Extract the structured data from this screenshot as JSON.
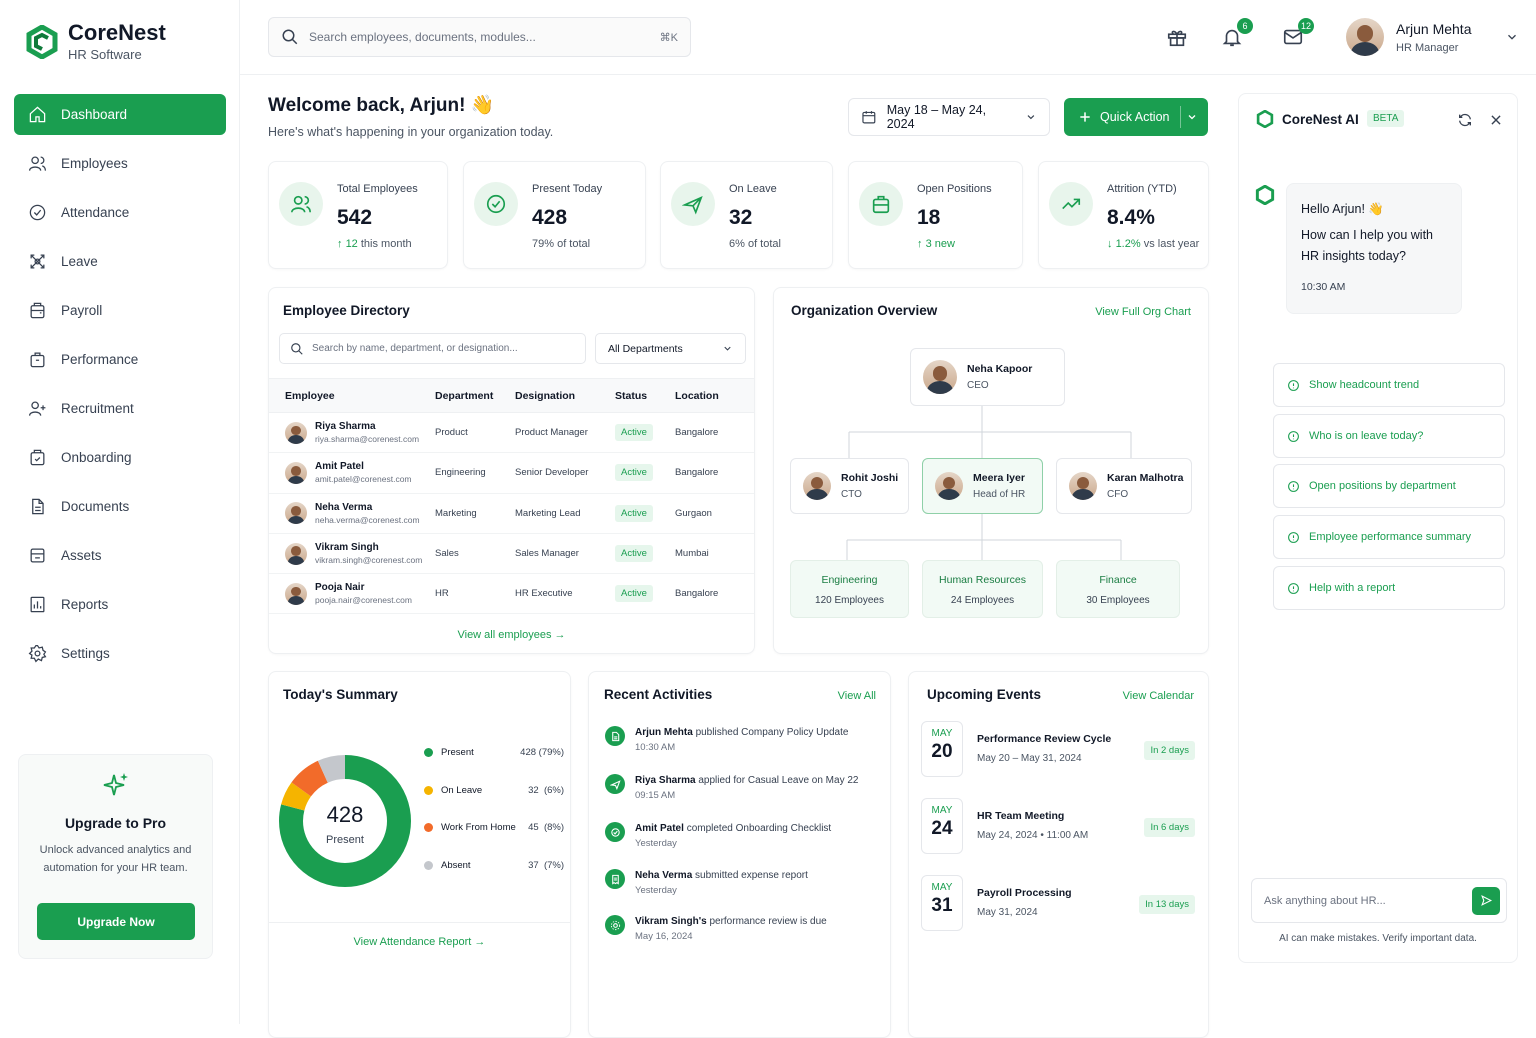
{
  "brand": {
    "name": "CoreNest",
    "subtitle": "HR Software"
  },
  "sidebar": {
    "items": [
      {
        "label": "Dashboard",
        "icon": "home-icon",
        "active": true
      },
      {
        "label": "Employees",
        "icon": "users-icon"
      },
      {
        "label": "Attendance",
        "icon": "check-circle-icon"
      },
      {
        "label": "Leave",
        "icon": "leave-icon"
      },
      {
        "label": "Payroll",
        "icon": "wallet-icon"
      },
      {
        "label": "Performance",
        "icon": "briefcase-icon"
      },
      {
        "label": "Recruitment",
        "icon": "user-plus-icon"
      },
      {
        "label": "Onboarding",
        "icon": "onboarding-icon"
      },
      {
        "label": "Documents",
        "icon": "document-icon"
      },
      {
        "label": "Assets",
        "icon": "assets-icon"
      },
      {
        "label": "Reports",
        "icon": "reports-icon"
      },
      {
        "label": "Settings",
        "icon": "gear-icon"
      }
    ],
    "upgrade": {
      "title": "Upgrade to Pro",
      "text": "Unlock advanced analytics and automation for your HR team.",
      "button": "Upgrade Now"
    }
  },
  "topbar": {
    "search_placeholder": "Search employees, documents, modules...",
    "shortcut": "⌘K",
    "notifications_count": "6",
    "messages_count": "12",
    "user": {
      "name": "Arjun Mehta",
      "role": "HR Manager"
    }
  },
  "header": {
    "welcome": "Welcome back, Arjun! 👋",
    "subtitle": "Here's what's happening in your organization today.",
    "date_range": "May 18 – May 24, 2024",
    "quick_action": "Quick Action"
  },
  "stats": [
    {
      "label": "Total Employees",
      "value": "542",
      "delta": "12",
      "note": "this month"
    },
    {
      "label": "Present Today",
      "value": "428",
      "delta": "",
      "note": "79% of total"
    },
    {
      "label": "On Leave",
      "value": "32",
      "delta": "",
      "note": "6% of total"
    },
    {
      "label": "Open Positions",
      "value": "18",
      "delta": "3",
      "note": "new"
    },
    {
      "label": "Attrition (YTD)",
      "value": "8.4%",
      "delta": "1.2%",
      "note": "vs last year"
    }
  ],
  "directory": {
    "title": "Employee Directory",
    "search_placeholder": "Search by name, department, or designation...",
    "dept_filter": "All Departments",
    "columns": [
      "Employee",
      "Department",
      "Designation",
      "Status",
      "Location"
    ],
    "rows": [
      {
        "name": "Riya Sharma",
        "email": "riya.sharma@corenest.com",
        "dept": "Product",
        "desig": "Product Manager",
        "status": "Active",
        "loc": "Bangalore"
      },
      {
        "name": "Amit Patel",
        "email": "amit.patel@corenest.com",
        "dept": "Engineering",
        "desig": "Senior Developer",
        "status": "Active",
        "loc": "Bangalore"
      },
      {
        "name": "Neha Verma",
        "email": "neha.verma@corenest.com",
        "dept": "Marketing",
        "desig": "Marketing Lead",
        "status": "Active",
        "loc": "Gurgaon"
      },
      {
        "name": "Vikram Singh",
        "email": "vikram.singh@corenest.com",
        "dept": "Sales",
        "desig": "Sales Manager",
        "status": "Active",
        "loc": "Mumbai"
      },
      {
        "name": "Pooja Nair",
        "email": "pooja.nair@corenest.com",
        "dept": "HR",
        "desig": "HR Executive",
        "status": "Active",
        "loc": "Bangalore"
      }
    ],
    "view_all": "View all employees"
  },
  "org": {
    "title": "Organization Overview",
    "link": "View Full Org Chart",
    "ceo": {
      "name": "Neha Kapoor",
      "role": "CEO"
    },
    "execs": [
      {
        "name": "Rohit Joshi",
        "role": "CTO"
      },
      {
        "name": "Meera Iyer",
        "role": "Head of HR"
      },
      {
        "name": "Karan Malhotra",
        "role": "CFO"
      }
    ],
    "departments": [
      {
        "name": "Engineering",
        "count": "120 Employees"
      },
      {
        "name": "Human Resources",
        "count": "24 Employees"
      },
      {
        "name": "Finance",
        "count": "30 Employees"
      }
    ]
  },
  "summary": {
    "title": "Today's Summary",
    "center_value": "428",
    "center_label": "Present",
    "legend": [
      {
        "label": "Present",
        "value": "428",
        "pct": "(79%)",
        "color": "#1a9e50",
        "count": 428
      },
      {
        "label": "On Leave",
        "value": "32",
        "pct": "(6%)",
        "color": "#f5b400",
        "count": 32
      },
      {
        "label": "Work From Home",
        "value": "45",
        "pct": "(8%)",
        "color": "#f26b2a",
        "count": 45
      },
      {
        "label": "Absent",
        "value": "37",
        "pct": "(7%)",
        "color": "#c4c7cc",
        "count": 37
      }
    ],
    "link": "View Attendance Report"
  },
  "activities": {
    "title": "Recent Activities",
    "link": "View All",
    "items": [
      {
        "who": "Arjun Mehta",
        "what": "published Company Policy Update",
        "time": "10:30 AM"
      },
      {
        "who": "Riya Sharma",
        "what": "applied for Casual Leave on May 22",
        "time": "09:15 AM"
      },
      {
        "who": "Amit Patel",
        "what": "completed Onboarding Checklist",
        "time": "Yesterday"
      },
      {
        "who": "Neha Verma",
        "what": "submitted expense report",
        "time": "Yesterday"
      },
      {
        "who": "Vikram Singh's",
        "what": "performance review is due",
        "time": "May 16, 2024"
      }
    ]
  },
  "events": {
    "title": "Upcoming Events",
    "link": "View Calendar",
    "items": [
      {
        "month": "MAY",
        "day": "20",
        "title": "Performance Review Cycle",
        "sub": "May 20 – May 31, 2024",
        "in": "In 2 days"
      },
      {
        "month": "MAY",
        "day": "24",
        "title": "HR Team Meeting",
        "sub": "May 24, 2024 • 11:00 AM",
        "in": "In 6 days"
      },
      {
        "month": "MAY",
        "day": "31",
        "title": "Payroll Processing",
        "sub": "May 31, 2024",
        "in": "In 13 days"
      }
    ]
  },
  "ai": {
    "title": "CoreNest AI",
    "badge": "BETA",
    "greeting": "Hello Arjun! 👋",
    "message": "How can I help you with HR insights today?",
    "time": "10:30 AM",
    "suggestions": [
      "Show headcount trend",
      "Who is on leave today?",
      "Open positions by department",
      "Employee performance summary",
      "Help with a report"
    ],
    "input_placeholder": "Ask anything about HR...",
    "disclaimer": "AI can make mistakes. Verify important data."
  }
}
